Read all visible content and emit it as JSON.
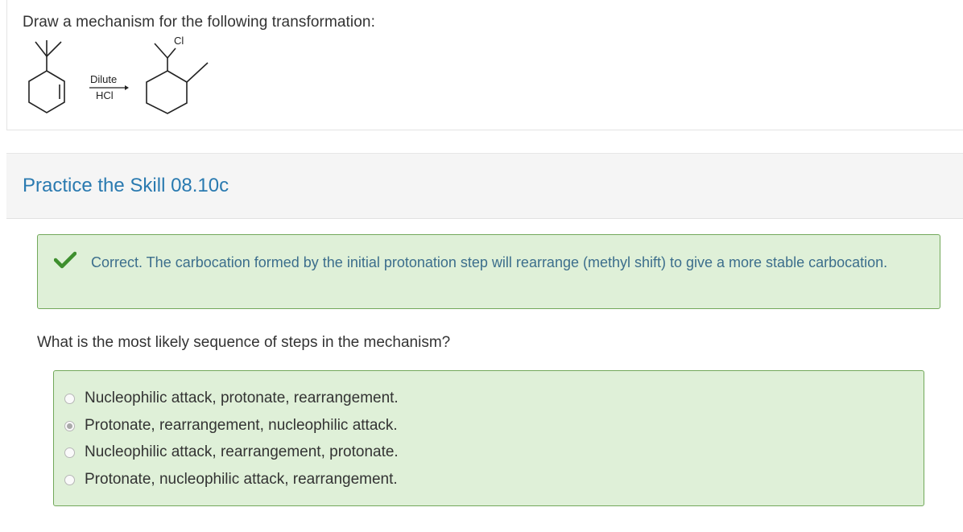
{
  "question_card": {
    "prompt": "Draw a mechanism for the following transformation:",
    "reaction": {
      "reagent_top": "Dilute",
      "reagent_bottom": "HCl",
      "product_substituent": "Cl"
    }
  },
  "skill": {
    "title": "Practice the Skill 08.10c"
  },
  "feedback": {
    "status": "correct",
    "text": "Correct. The carbocation formed by the initial protonation step will rearrange (methyl shift) to give a more stable carbocation.",
    "icon": "checkmark-icon",
    "color": "#3e8f2e"
  },
  "question": {
    "text": "What is the most likely sequence of steps in the mechanism?",
    "options": [
      {
        "label": "Nucleophilic attack, protonate, rearrangement.",
        "selected": false
      },
      {
        "label": "Protonate, rearrangement, nucleophilic attack.",
        "selected": true
      },
      {
        "label": "Nucleophilic attack, rearrangement, protonate.",
        "selected": false
      },
      {
        "label": "Protonate, nucleophilic attack, rearrangement.",
        "selected": false
      }
    ]
  },
  "colors": {
    "accent_title": "#2a7ab0",
    "success_bg": "#dff0d8",
    "success_border": "#72a85a",
    "feedback_text": "#3c6e8c"
  }
}
